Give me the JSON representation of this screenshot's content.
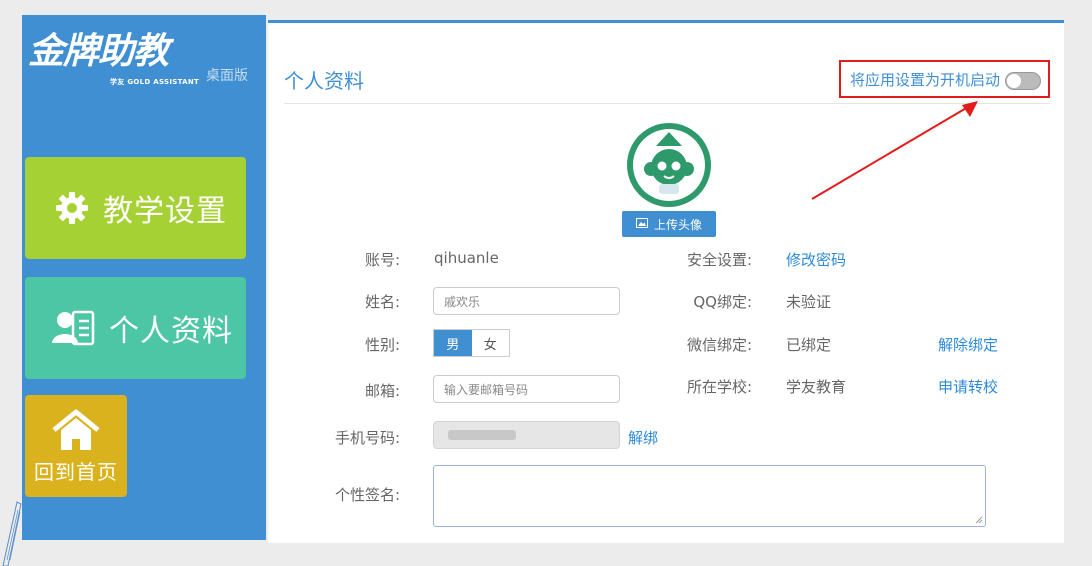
{
  "sidebar": {
    "logo_text": "金牌助教",
    "logo_sub": "学友 GOLD ASSISTANT",
    "edition": "桌面版",
    "items": [
      {
        "label": "教学设置",
        "icon": "gear-icon",
        "color": "#a5d135"
      },
      {
        "label": "个人资料",
        "icon": "profile-card-icon",
        "color": "#4cc6a4"
      },
      {
        "label": "回到首页",
        "icon": "home-icon",
        "color": "#d9b21d"
      }
    ]
  },
  "header": {
    "title": "个人资料",
    "autostart_label": "将应用设置为开机启动",
    "autostart_on": false
  },
  "avatar": {
    "upload_label": "上传头像"
  },
  "form": {
    "account_label": "账号:",
    "account_value": "qihuanle",
    "name_label": "姓名:",
    "name_value": "戚欢乐",
    "gender_label": "性别:",
    "gender_options": [
      "男",
      "女"
    ],
    "gender_selected": "男",
    "email_label": "邮箱:",
    "email_placeholder": "输入要邮箱号码",
    "phone_label": "手机号码:",
    "phone_unbind": "解绑",
    "signature_label": "个性签名:"
  },
  "bindings": {
    "security_label": "安全设置:",
    "change_password": "修改密码",
    "qq_label": "QQ绑定:",
    "qq_value": "未验证",
    "wechat_label": "微信绑定:",
    "wechat_value": "已绑定",
    "wechat_unbind": "解除绑定",
    "school_label": "所在学校:",
    "school_value": "学友教育",
    "school_transfer": "申请转校"
  },
  "colors": {
    "brand_blue": "#3f8fd2",
    "link_blue": "#2d8ad8",
    "highlight_red": "#e41b1b"
  }
}
